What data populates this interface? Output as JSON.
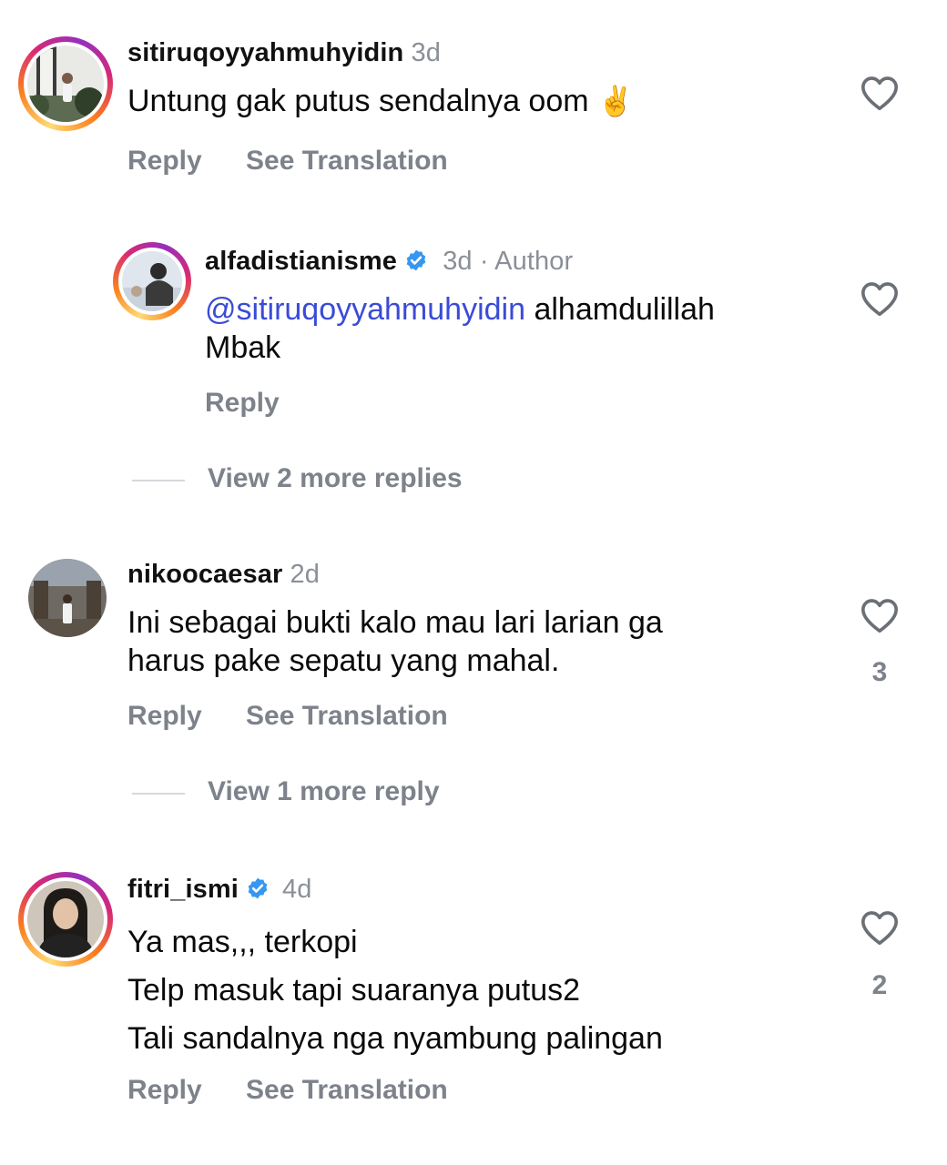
{
  "comments": [
    {
      "username": "sitiruqoyyahmuhyidin",
      "time": "3d",
      "text_lines": [
        "Untung gak putus sendalnya oom"
      ],
      "emoji": "✌️",
      "reply_label": "Reply",
      "translate_label": "See Translation"
    },
    {
      "username": "alfadistianisme",
      "verified": true,
      "time": "3d",
      "author_tag": "· Author",
      "mention": "@sitiruqoyyahmuhyidin",
      "text_lines": [
        "alhamdulillah",
        "Mbak"
      ],
      "reply_label": "Reply"
    },
    {
      "view_more": "View 2 more replies"
    },
    {
      "username": "nikoocaesar",
      "time": "2d",
      "text_lines": [
        "Ini sebagai bukti kalo mau lari larian ga",
        "harus pake sepatu yang mahal."
      ],
      "likes": "3",
      "reply_label": "Reply",
      "translate_label": "See Translation"
    },
    {
      "view_more": "View 1 more reply"
    },
    {
      "username": "fitri_ismi",
      "verified": true,
      "time": "4d",
      "text_lines": [
        "Ya mas,,, terkopi",
        "Telp masuk tapi suaranya putus2",
        "Tali sandalnya nga nyambung palingan"
      ],
      "likes": "2",
      "reply_label": "Reply",
      "translate_label": "See Translation"
    }
  ],
  "colors": {
    "verified": "#3797f0",
    "mention": "#3a4bd8",
    "muted": "#7d828b"
  },
  "icons": {
    "like": "heart-outline-icon",
    "verified": "verified-badge-icon"
  }
}
